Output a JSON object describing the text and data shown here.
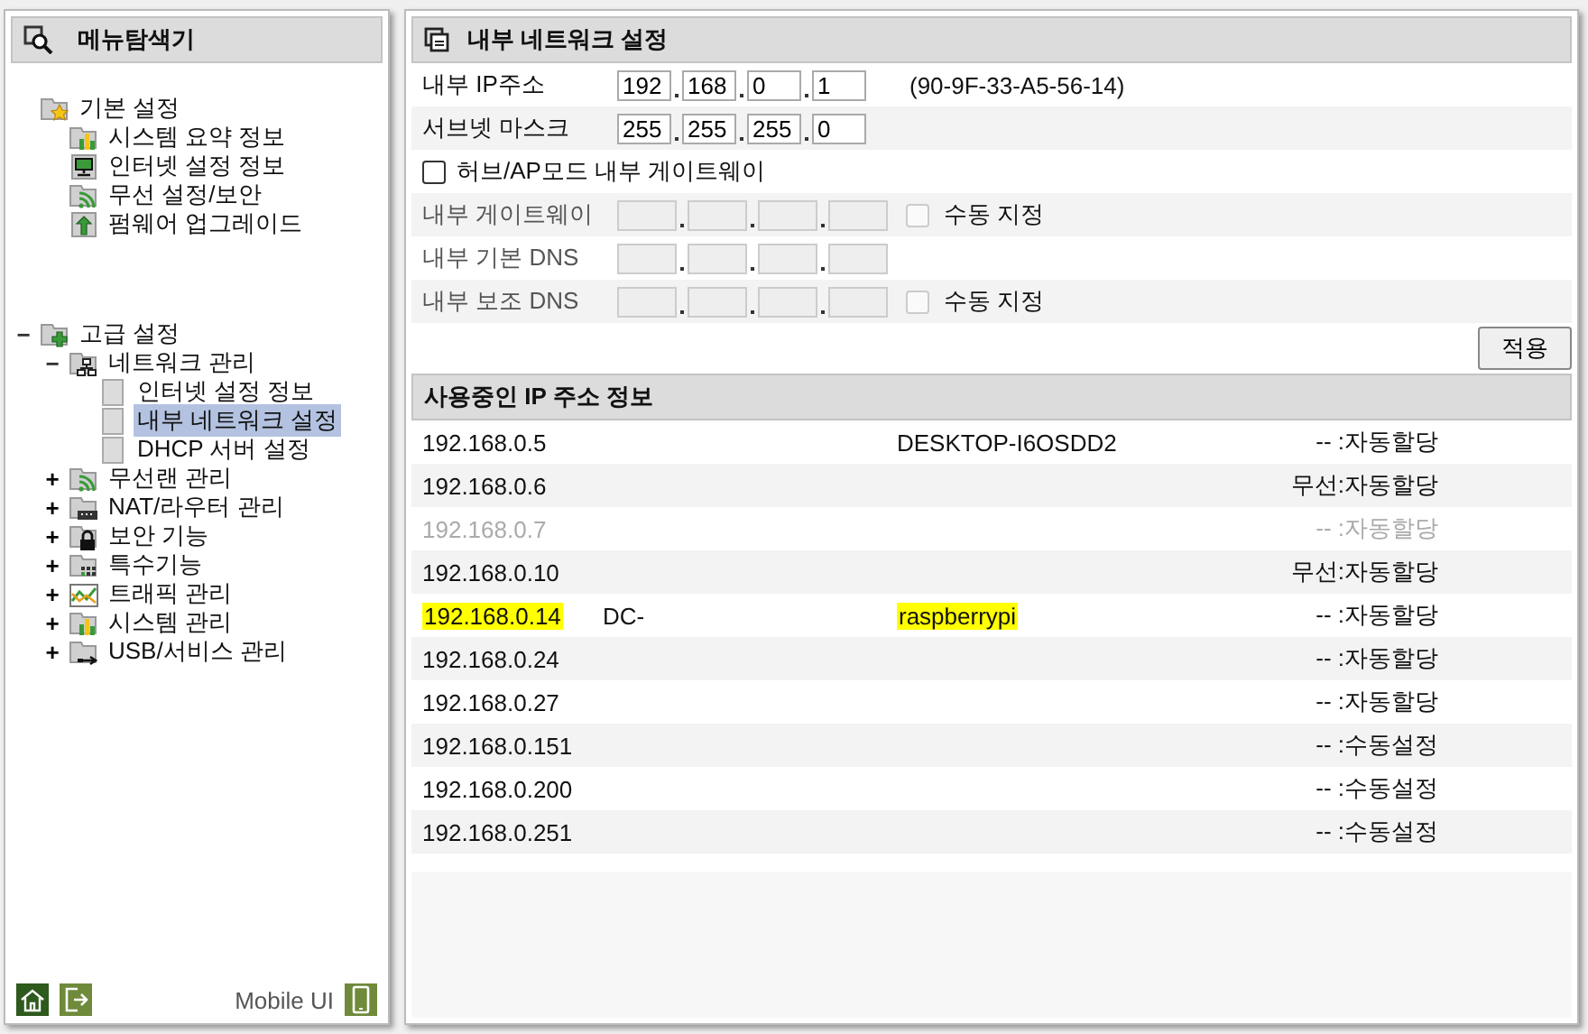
{
  "sidebar": {
    "title": "메뉴탐색기",
    "tree": [
      {
        "label": "기본 설정",
        "kind": "folder-star",
        "children": [
          {
            "label": "시스템 요약 정보",
            "kind": "chart",
            "selected": false
          },
          {
            "label": "인터넷 설정 정보",
            "kind": "monitor",
            "selected": false
          },
          {
            "label": "무선 설정/보안",
            "kind": "wifi",
            "selected": false
          },
          {
            "label": "펌웨어 업그레이드",
            "kind": "upgrade",
            "selected": false
          }
        ]
      },
      {
        "label": "고급 설정",
        "kind": "folder-plus",
        "toggle": "−",
        "expanded": true,
        "children": [
          {
            "label": "네트워크 관리",
            "kind": "network",
            "toggle": "−",
            "expanded": true,
            "children": [
              {
                "label": "인터넷 설정 정보",
                "kind": "page",
                "selected": false
              },
              {
                "label": "내부 네트워크 설정",
                "kind": "page",
                "selected": true
              },
              {
                "label": "DHCP 서버 설정",
                "kind": "page",
                "selected": false
              }
            ]
          },
          {
            "label": "무선랜 관리",
            "kind": "wifi",
            "toggle": "+",
            "expanded": false
          },
          {
            "label": "NAT/라우터 관리",
            "kind": "router",
            "toggle": "+",
            "expanded": false
          },
          {
            "label": "보안 기능",
            "kind": "lock",
            "toggle": "+",
            "expanded": false
          },
          {
            "label": "특수기능",
            "kind": "grid",
            "toggle": "+",
            "expanded": false
          },
          {
            "label": "트래픽 관리",
            "kind": "traffic",
            "toggle": "+",
            "expanded": false
          },
          {
            "label": "시스템 관리",
            "kind": "chart",
            "toggle": "+",
            "expanded": false
          },
          {
            "label": "USB/서비스 관리",
            "kind": "usb",
            "toggle": "+",
            "expanded": false
          }
        ]
      }
    ],
    "mobile_label": "Mobile UI"
  },
  "panel": {
    "title": "내부 네트워크 설정",
    "form": [
      {
        "kind": "ip",
        "label": "내부 IP주소",
        "octets": [
          "192",
          "168",
          "0",
          "1"
        ],
        "disabled": false,
        "note": "(90-9F-33-A5-56-14)"
      },
      {
        "kind": "ip",
        "label": "서브넷 마스크",
        "octets": [
          "255",
          "255",
          "255",
          "0"
        ],
        "disabled": false
      },
      {
        "kind": "checkbox",
        "label": "허브/AP모드 내부 게이트웨이",
        "checked": false
      },
      {
        "kind": "ip",
        "label": "내부 게이트웨이",
        "disabled": true,
        "manual": {
          "label": "수동 지정",
          "checked": false
        }
      },
      {
        "kind": "ip",
        "label": "내부 기본 DNS",
        "disabled": true
      },
      {
        "kind": "ip",
        "label": "내부 보조 DNS",
        "disabled": true,
        "manual": {
          "label": "수동 지정",
          "checked": false
        }
      }
    ],
    "apply_button": "적용",
    "leases_title": "사용중인 IP 주소 정보",
    "leases": [
      {
        "ip": "192.168.0.5",
        "host": "DESKTOP-I6OSDD2",
        "type": "-- :자동할당",
        "highlighted": false,
        "inactive": false
      },
      {
        "ip": "192.168.0.6",
        "type": "무선:자동할당",
        "highlighted": false,
        "inactive": false
      },
      {
        "ip": "192.168.0.7",
        "type": "-- :자동할당",
        "highlighted": false,
        "inactive": true
      },
      {
        "ip": "192.168.0.10",
        "type": "무선:자동할당",
        "highlighted": false,
        "inactive": false
      },
      {
        "ip": "192.168.0.14",
        "mac": "DC-",
        "host": "raspberrypi",
        "type": "-- :자동할당",
        "highlighted": true,
        "inactive": false
      },
      {
        "ip": "192.168.0.24",
        "type": "-- :자동할당",
        "highlighted": false,
        "inactive": false
      },
      {
        "ip": "192.168.0.27",
        "type": "-- :자동할당",
        "highlighted": false,
        "inactive": false
      },
      {
        "ip": "192.168.0.151",
        "type": "-- :수동설정",
        "highlighted": false,
        "inactive": false
      },
      {
        "ip": "192.168.0.200",
        "type": "-- :수동설정",
        "highlighted": false,
        "inactive": false
      },
      {
        "ip": "192.168.0.251",
        "type": "-- :수동설정",
        "highlighted": false,
        "inactive": false
      }
    ]
  }
}
